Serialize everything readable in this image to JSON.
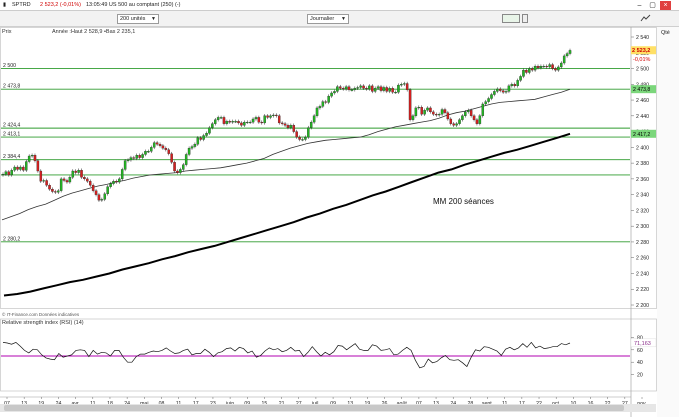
{
  "window": {
    "title_symbol": "SPTRD",
    "title_quote": "2 523,2 (-0,01%)",
    "title_rest": "13:05:49 US 500 au comptant (250) (-)"
  },
  "toolbar": {
    "units": "200 unités",
    "period": "Journalier"
  },
  "right_panel": {
    "label": "Qté"
  },
  "legend": {
    "prix": "Prix",
    "info": "Année :Haut 2 528,9 •Bas 2 235,1",
    "source": "© IT-Finance.com Données indicatives"
  },
  "annotation": "MM 200 séances",
  "last_price": {
    "value": "2 523,2",
    "change": "-0,01%"
  },
  "levels": [
    {
      "label": "2 500",
      "value": 2500,
      "show_label": true
    },
    {
      "label": "2 473,8",
      "value": 2473.8,
      "show_label": true
    },
    {
      "label": "2 424,4",
      "value": 2424.4,
      "show_label": true
    },
    {
      "label": "2 413,1",
      "value": 2413.1,
      "show_label": true
    },
    {
      "label": "2 384,4",
      "value": 2384.4,
      "show_label": true
    },
    {
      "label": "2 365",
      "value": 2365,
      "show_label": false
    },
    {
      "label": "2 280,2",
      "value": 2280.2,
      "show_label": true
    }
  ],
  "right_tags": [
    {
      "label": "2 473,8",
      "value": 2473.8
    },
    {
      "label": "2 417,2",
      "value": 2417.2
    }
  ],
  "rsi": {
    "title": "Relative strength index (RSI) (14)",
    "value_label": "71,163",
    "ticks": [
      "80",
      "60",
      "40",
      "20"
    ],
    "threshold": 50
  },
  "chart_data": {
    "type": "candlestick",
    "ylim": [
      2200,
      2540
    ],
    "yticks": [
      2540,
      2520,
      2500,
      2480,
      2460,
      2440,
      2420,
      2400,
      2380,
      2360,
      2340,
      2320,
      2300,
      2280,
      2260,
      2240,
      2220,
      2200
    ],
    "x_tick_labels": [
      "07",
      "13",
      "19",
      "24",
      "avr.",
      "11",
      "18",
      "24",
      "mai",
      "08",
      "11",
      "17",
      "23",
      "juin",
      "09",
      "15",
      "21",
      "27",
      "juil.",
      "09",
      "13",
      "19",
      "26",
      "août",
      "07",
      "13",
      "24",
      "28",
      "sept.",
      "11",
      "17",
      "22",
      "oct.",
      "10",
      "16",
      "22",
      "27",
      "nov."
    ],
    "closes": [
      2366,
      2369,
      2365,
      2371,
      2375,
      2372,
      2375,
      2371,
      2382,
      2389,
      2390,
      2383,
      2370,
      2357,
      2358,
      2352,
      2347,
      2344,
      2343,
      2345,
      2360,
      2358,
      2356,
      2362,
      2370,
      2368,
      2371,
      2362,
      2360,
      2357,
      2352,
      2345,
      2340,
      2333,
      2334,
      2341,
      2350,
      2354,
      2357,
      2356,
      2360,
      2372,
      2383,
      2384,
      2387,
      2386,
      2390,
      2387,
      2391,
      2395,
      2395,
      2400,
      2406,
      2404,
      2402,
      2399,
      2397,
      2392,
      2381,
      2370,
      2368,
      2372,
      2378,
      2391,
      2399,
      2401,
      2404,
      2412,
      2410,
      2415,
      2418,
      2425,
      2430,
      2435,
      2438,
      2438,
      2430,
      2433,
      2432,
      2433,
      2433,
      2431,
      2428,
      2432,
      2432,
      2432,
      2436,
      2438,
      2432,
      2431,
      2440,
      2438,
      2440,
      2441,
      2440,
      2431,
      2430,
      2428,
      2425,
      2428,
      2420,
      2413,
      2410,
      2410,
      2413,
      2425,
      2432,
      2440,
      2450,
      2452,
      2458,
      2457,
      2465,
      2469,
      2471,
      2477,
      2475,
      2474,
      2477,
      2473,
      2473,
      2475,
      2476,
      2478,
      2475,
      2474,
      2478,
      2471,
      2475,
      2477,
      2472,
      2476,
      2471,
      2475,
      2470,
      2470,
      2479,
      2480,
      2481,
      2473,
      2435,
      2440,
      2450,
      2451,
      2442,
      2447,
      2450,
      2445,
      2442,
      2441,
      2442,
      2448,
      2444,
      2436,
      2430,
      2428,
      2430,
      2435,
      2440,
      2445,
      2447,
      2440,
      2435,
      2430,
      2440,
      2455,
      2458,
      2462,
      2467,
      2471,
      2474,
      2472,
      2470,
      2471,
      2478,
      2480,
      2478,
      2485,
      2490,
      2498,
      2495,
      2500,
      2498,
      2503,
      2501,
      2503,
      2503,
      2502,
      2505,
      2500,
      2498,
      2502,
      2507,
      2516,
      2519,
      2523
    ],
    "ma_short": [
      2308,
      2312,
      2316,
      2321,
      2325,
      2328,
      2333,
      2338,
      2342,
      2345,
      2348,
      2351,
      2353,
      2356,
      2358,
      2361,
      2363,
      2365,
      2366,
      2367,
      2368,
      2370,
      2371,
      2372,
      2373,
      2374,
      2376,
      2378,
      2380,
      2383,
      2386,
      2391,
      2395,
      2399,
      2402,
      2405,
      2407,
      2409,
      2410,
      2411,
      2412,
      2413,
      2416,
      2420,
      2423,
      2426,
      2428,
      2430,
      2432,
      2434,
      2437,
      2441,
      2444,
      2446,
      2449,
      2452,
      2455,
      2457,
      2458,
      2459,
      2460,
      2461,
      2464,
      2467,
      2470,
      2473.8
    ],
    "ma_200": [
      2212,
      2214,
      2217,
      2221,
      2225,
      2229,
      2232,
      2236,
      2240,
      2245,
      2249,
      2253,
      2258,
      2262,
      2267,
      2271,
      2275,
      2280,
      2285,
      2290,
      2295,
      2300,
      2305,
      2311,
      2316,
      2322,
      2327,
      2333,
      2339,
      2344,
      2350,
      2356,
      2362,
      2368,
      2372,
      2378,
      2383,
      2388,
      2393,
      2397,
      2402,
      2407,
      2412,
      2417.2
    ],
    "rsi_values": [
      72,
      71,
      69,
      72,
      66,
      59,
      55,
      61,
      60,
      52,
      47,
      45,
      44,
      54,
      48,
      50,
      52,
      59,
      60,
      59,
      49,
      59,
      53,
      56,
      55,
      50,
      59,
      59,
      48,
      40,
      40,
      49,
      53,
      53,
      56,
      58,
      57,
      59,
      63,
      58,
      54,
      55,
      59,
      61,
      52,
      54,
      54,
      61,
      56,
      49,
      55,
      57,
      62,
      63,
      58,
      64,
      62,
      55,
      58,
      48,
      51,
      58,
      63,
      60,
      62,
      57,
      59,
      64,
      58,
      59,
      49,
      56,
      65,
      57,
      50,
      56,
      52,
      57,
      67,
      66,
      60,
      65,
      70,
      61,
      59,
      59,
      68,
      66,
      59,
      60,
      62,
      52,
      53,
      59,
      64,
      59,
      43,
      31,
      33,
      45,
      39,
      41,
      47,
      51,
      44,
      43,
      44,
      39,
      33,
      48,
      60,
      58,
      65,
      64,
      61,
      58,
      51,
      61,
      64,
      60,
      63,
      70,
      64,
      72,
      63,
      66,
      62,
      63,
      65,
      65,
      70,
      68,
      71
    ]
  }
}
